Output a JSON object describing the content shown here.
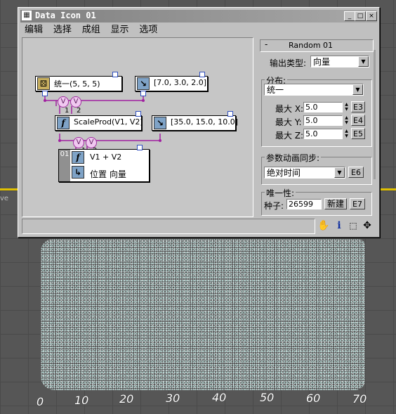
{
  "window": {
    "title": "Data Icon 01",
    "minimize": "_",
    "maximize": "□",
    "close": "×"
  },
  "menu": [
    "编辑",
    "选择",
    "成组",
    "显示",
    "选项"
  ],
  "canvas": {
    "node_uniform": "统一(5, 5, 5)",
    "node_vec1": "[7.0, 3.0, 2.0]",
    "node_scaleprod": "ScaleProd(V1, V2)",
    "node_vec2": "[35.0, 15.0, 10.0]",
    "op_index": "01",
    "op_line1": "V1 + V2",
    "op_line2": "位置 向量",
    "v_label": "V",
    "port_1": "1",
    "port_2": "2"
  },
  "panel": {
    "header_toggle": "-",
    "header_title": "Random 01",
    "output_type_label": "输出类型:",
    "output_type_value": "向量",
    "distribution_caption": "分布:",
    "distribution_value": "统一",
    "max_x_label": "最大 X:",
    "max_x_value": "5.0",
    "max_y_label": "最大 Y:",
    "max_y_value": "5.0",
    "max_z_label": "最大 Z:",
    "max_z_value": "5.0",
    "btn_e3": "E3",
    "btn_e4": "E4",
    "btn_e5": "E5",
    "sync_caption": "参数动画同步:",
    "sync_value": "绝对时间",
    "btn_e6": "E6",
    "unique_caption": "唯一性:",
    "seed_label": "种子:",
    "seed_value": "26599",
    "new_button": "新建",
    "btn_e7": "E7"
  },
  "viewport": {
    "side_label": "ve",
    "ruler": [
      "0",
      "10",
      "20",
      "30",
      "40",
      "50",
      "60",
      "70"
    ]
  },
  "icons": {
    "hand": "pan-hand-icon",
    "info": "info-icon",
    "select": "region-select-icon",
    "move": "move-icon"
  }
}
